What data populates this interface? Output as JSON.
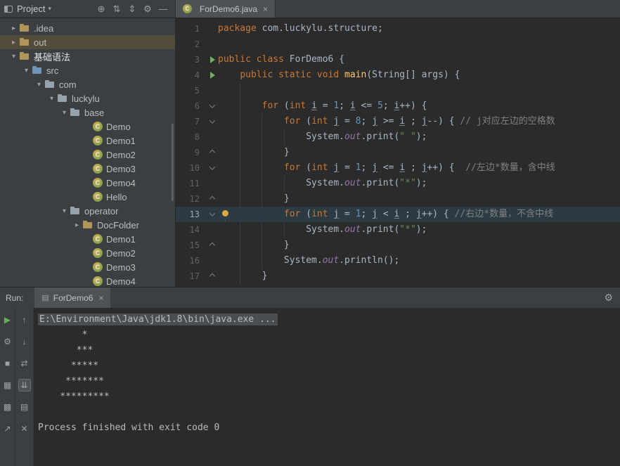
{
  "colors": {
    "panel_bg": "#3c3f41",
    "editor_bg": "#2b2b2b",
    "keyword": "#cc7832",
    "string": "#6a8759",
    "comment": "#808080",
    "number": "#6897bb",
    "default_text": "#a9b7c6",
    "field": "#9876aa",
    "method": "#ffc66b",
    "caret_row": "#2c3a43",
    "tree_selection": "#534c3a",
    "run_green": "#64b05e"
  },
  "project_panel": {
    "title": "Project",
    "caret": "▾",
    "toolbar_icons": [
      {
        "name": "locate-file",
        "glyph": "⊕"
      },
      {
        "name": "collapse-all",
        "glyph": "⇅"
      },
      {
        "name": "sort-options",
        "glyph": "⇕"
      },
      {
        "name": "settings",
        "glyph": "⚙"
      },
      {
        "name": "hide-panel",
        "glyph": "—"
      }
    ],
    "tree": [
      {
        "label": ".idea",
        "depth": 0,
        "chev": "right",
        "icon": "folder"
      },
      {
        "label": "out",
        "depth": 0,
        "chev": "right",
        "icon": "folder",
        "selected": true
      },
      {
        "label": "基础语法",
        "depth": 0,
        "chev": "down",
        "icon": "folder",
        "bold": true
      },
      {
        "label": "src",
        "depth": 1,
        "chev": "down",
        "icon": "src"
      },
      {
        "label": "com",
        "depth": 2,
        "chev": "down",
        "icon": "pkg"
      },
      {
        "label": "luckylu",
        "depth": 3,
        "chev": "down",
        "icon": "pkg"
      },
      {
        "label": "base",
        "depth": 4,
        "chev": "down",
        "icon": "pkg"
      },
      {
        "label": "Demo",
        "depth": 5,
        "icon": "class"
      },
      {
        "label": "Demo1",
        "depth": 5,
        "icon": "class"
      },
      {
        "label": "Demo2",
        "depth": 5,
        "icon": "class"
      },
      {
        "label": "Demo3",
        "depth": 5,
        "icon": "class"
      },
      {
        "label": "Demo4",
        "depth": 5,
        "icon": "class"
      },
      {
        "label": "Hello",
        "depth": 5,
        "icon": "class"
      },
      {
        "label": "operator",
        "depth": 4,
        "chev": "down",
        "icon": "pkg"
      },
      {
        "label": "DocFolder",
        "depth": 5,
        "chev": "right",
        "icon": "folder"
      },
      {
        "label": "Demo1",
        "depth": 5,
        "icon": "class"
      },
      {
        "label": "Demo2",
        "depth": 5,
        "icon": "class"
      },
      {
        "label": "Demo3",
        "depth": 5,
        "icon": "class"
      },
      {
        "label": "Demo4",
        "depth": 5,
        "icon": "class"
      }
    ]
  },
  "editor": {
    "tab": {
      "label": "ForDemo6.java",
      "close": "×"
    },
    "run_arrow_lines": [
      3,
      4
    ],
    "fold_open_lines": [
      6,
      7,
      10,
      13
    ],
    "fold_close_lines": [
      9,
      12,
      15,
      17
    ],
    "current_line": 13,
    "bulb_line": 13,
    "lines": [
      {
        "n": 1,
        "seg": [
          [
            "k",
            "package"
          ],
          [
            "d",
            " com.luckylu.structure;"
          ]
        ]
      },
      {
        "n": 2,
        "seg": []
      },
      {
        "n": 3,
        "seg": [
          [
            "k",
            "public class"
          ],
          [
            "d",
            " ForDemo6 {"
          ]
        ]
      },
      {
        "n": 4,
        "seg": [
          [
            "d",
            "    "
          ],
          [
            "k",
            "public static void"
          ],
          [
            "d",
            " "
          ],
          [
            "m",
            "main"
          ],
          [
            "d",
            "(String[] args) {"
          ]
        ]
      },
      {
        "n": 5,
        "seg": []
      },
      {
        "n": 6,
        "seg": [
          [
            "d",
            "        "
          ],
          [
            "k",
            "for"
          ],
          [
            "d",
            " ("
          ],
          [
            "k",
            "int"
          ],
          [
            "d",
            " "
          ],
          [
            "u",
            "i"
          ],
          [
            "d",
            " = "
          ],
          [
            "n",
            "1"
          ],
          [
            "d",
            "; "
          ],
          [
            "u",
            "i"
          ],
          [
            "d",
            " <= "
          ],
          [
            "n",
            "5"
          ],
          [
            "d",
            "; "
          ],
          [
            "u",
            "i"
          ],
          [
            "d",
            "++) {"
          ]
        ]
      },
      {
        "n": 7,
        "seg": [
          [
            "d",
            "            "
          ],
          [
            "k",
            "for"
          ],
          [
            "d",
            " ("
          ],
          [
            "k",
            "int"
          ],
          [
            "d",
            " "
          ],
          [
            "u",
            "j"
          ],
          [
            "d",
            " = "
          ],
          [
            "n",
            "8"
          ],
          [
            "d",
            "; "
          ],
          [
            "u",
            "j"
          ],
          [
            "d",
            " >= "
          ],
          [
            "u",
            "i"
          ],
          [
            "d",
            " ; "
          ],
          [
            "u",
            "j"
          ],
          [
            "d",
            "--) { "
          ],
          [
            "c",
            "// j对应左边的空格数"
          ]
        ]
      },
      {
        "n": 8,
        "seg": [
          [
            "d",
            "                System."
          ],
          [
            "f",
            "out"
          ],
          [
            "d",
            ".print("
          ],
          [
            "s",
            "\" \""
          ],
          [
            "d",
            ");"
          ]
        ]
      },
      {
        "n": 9,
        "seg": [
          [
            "d",
            "            }"
          ]
        ]
      },
      {
        "n": 10,
        "seg": [
          [
            "d",
            "            "
          ],
          [
            "k",
            "for"
          ],
          [
            "d",
            " ("
          ],
          [
            "k",
            "int"
          ],
          [
            "d",
            " "
          ],
          [
            "u",
            "j"
          ],
          [
            "d",
            " = "
          ],
          [
            "n",
            "1"
          ],
          [
            "d",
            "; "
          ],
          [
            "u",
            "j"
          ],
          [
            "d",
            " <= "
          ],
          [
            "u",
            "i"
          ],
          [
            "d",
            " ; "
          ],
          [
            "u",
            "j"
          ],
          [
            "d",
            "++) {  "
          ],
          [
            "c",
            "//左边*数量，含中线"
          ]
        ]
      },
      {
        "n": 11,
        "seg": [
          [
            "d",
            "                System."
          ],
          [
            "f",
            "out"
          ],
          [
            "d",
            ".print("
          ],
          [
            "s",
            "\"*\""
          ],
          [
            "d",
            ");"
          ]
        ]
      },
      {
        "n": 12,
        "seg": [
          [
            "d",
            "            }"
          ]
        ]
      },
      {
        "n": 13,
        "seg": [
          [
            "d",
            "            "
          ],
          [
            "k",
            "for"
          ],
          [
            "d",
            " ("
          ],
          [
            "k",
            "int"
          ],
          [
            "d",
            " "
          ],
          [
            "u",
            "j"
          ],
          [
            "d",
            " = "
          ],
          [
            "n",
            "1"
          ],
          [
            "d",
            "; "
          ],
          [
            "u",
            "j"
          ],
          [
            "d",
            " < "
          ],
          [
            "u",
            "i"
          ],
          [
            "d",
            " ; "
          ],
          [
            "u",
            "j"
          ],
          [
            "d",
            "++) { "
          ],
          [
            "c",
            "//右边*数量，不含中线"
          ]
        ]
      },
      {
        "n": 14,
        "seg": [
          [
            "d",
            "                System."
          ],
          [
            "f",
            "out"
          ],
          [
            "d",
            ".print("
          ],
          [
            "s",
            "\"*\""
          ],
          [
            "d",
            ");"
          ]
        ]
      },
      {
        "n": 15,
        "seg": [
          [
            "d",
            "            }"
          ]
        ]
      },
      {
        "n": 16,
        "seg": [
          [
            "d",
            "            System."
          ],
          [
            "f",
            "out"
          ],
          [
            "d",
            ".println();"
          ]
        ]
      },
      {
        "n": 17,
        "seg": [
          [
            "d",
            "        }"
          ]
        ]
      },
      {
        "n": 18,
        "seg": []
      }
    ]
  },
  "run": {
    "label": "Run:",
    "tab": {
      "icon_glyph": "▤",
      "label": "ForDemo6",
      "close": "×"
    },
    "gear": "⚙",
    "outer_toolbar": [
      {
        "name": "rerun",
        "glyph": "▶",
        "green": true
      },
      {
        "name": "run-settings",
        "glyph": "⚙"
      },
      {
        "name": "stop",
        "glyph": "■"
      },
      {
        "name": "build",
        "glyph": "▦"
      },
      {
        "name": "dump-threads",
        "glyph": "▩"
      },
      {
        "name": "jump-to-source",
        "glyph": "↗"
      }
    ],
    "inner_toolbar": [
      {
        "name": "prev-occurrence",
        "glyph": "↑"
      },
      {
        "name": "next-occurrence",
        "glyph": "↓"
      },
      {
        "name": "soft-wrap",
        "glyph": "⇄"
      },
      {
        "name": "scroll-to-end",
        "glyph": "⇊",
        "active": true
      },
      {
        "name": "print",
        "glyph": "▤"
      },
      {
        "name": "clear-all",
        "glyph": "✕"
      }
    ],
    "console": [
      {
        "t": "E:\\Environment\\Java\\jdk1.8\\bin\\java.exe ...",
        "sel": true
      },
      {
        "t": "        *"
      },
      {
        "t": "       ***"
      },
      {
        "t": "      *****"
      },
      {
        "t": "     *******"
      },
      {
        "t": "    *********"
      },
      {
        "t": ""
      },
      {
        "t": "Process finished with exit code 0"
      }
    ]
  }
}
